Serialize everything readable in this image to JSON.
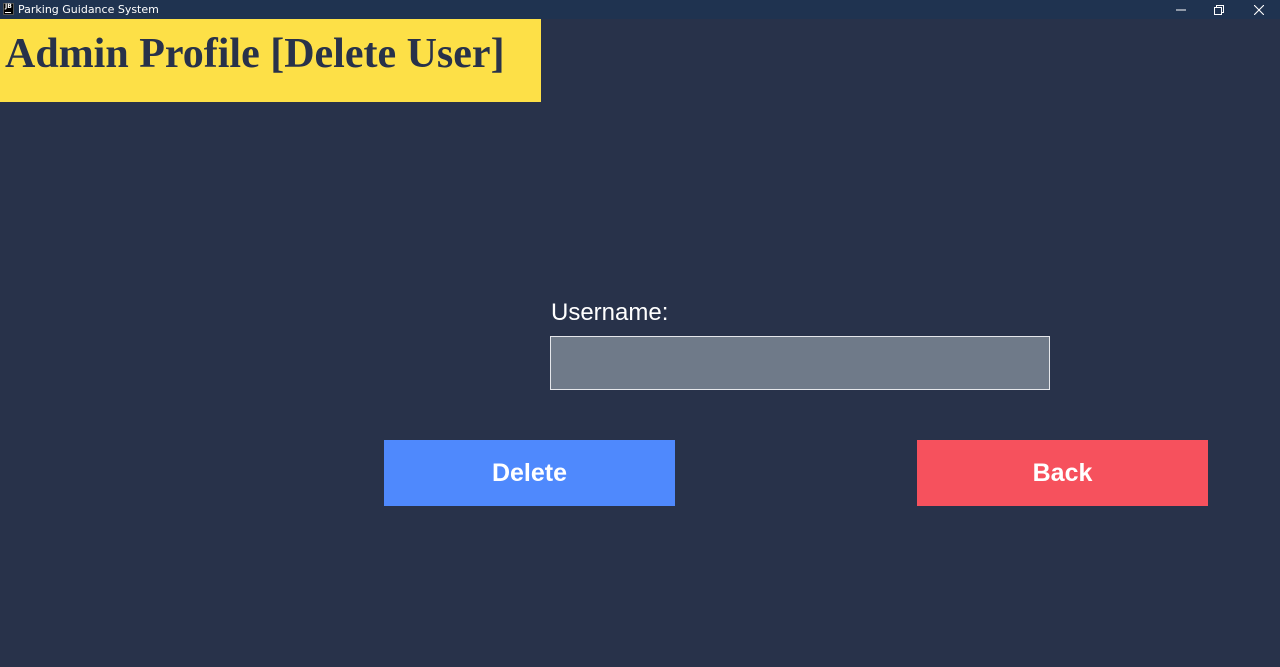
{
  "window": {
    "title": "Parking Guidance System",
    "app_icon_text": "JB",
    "controls": [
      "minimize-icon",
      "restore-icon",
      "close-icon"
    ]
  },
  "header": {
    "title": "Admin Profile [Delete User]",
    "background_color": "#fde047"
  },
  "form": {
    "username_label": "Username:",
    "username_value": "",
    "username_placeholder": ""
  },
  "buttons": {
    "delete_label": "Delete",
    "delete_color": "#4f89fd",
    "back_label": "Back",
    "back_color": "#f6515d"
  },
  "colors": {
    "background": "#28324a",
    "titlebar": "#1f3350",
    "input_background": "#6f7a89"
  }
}
